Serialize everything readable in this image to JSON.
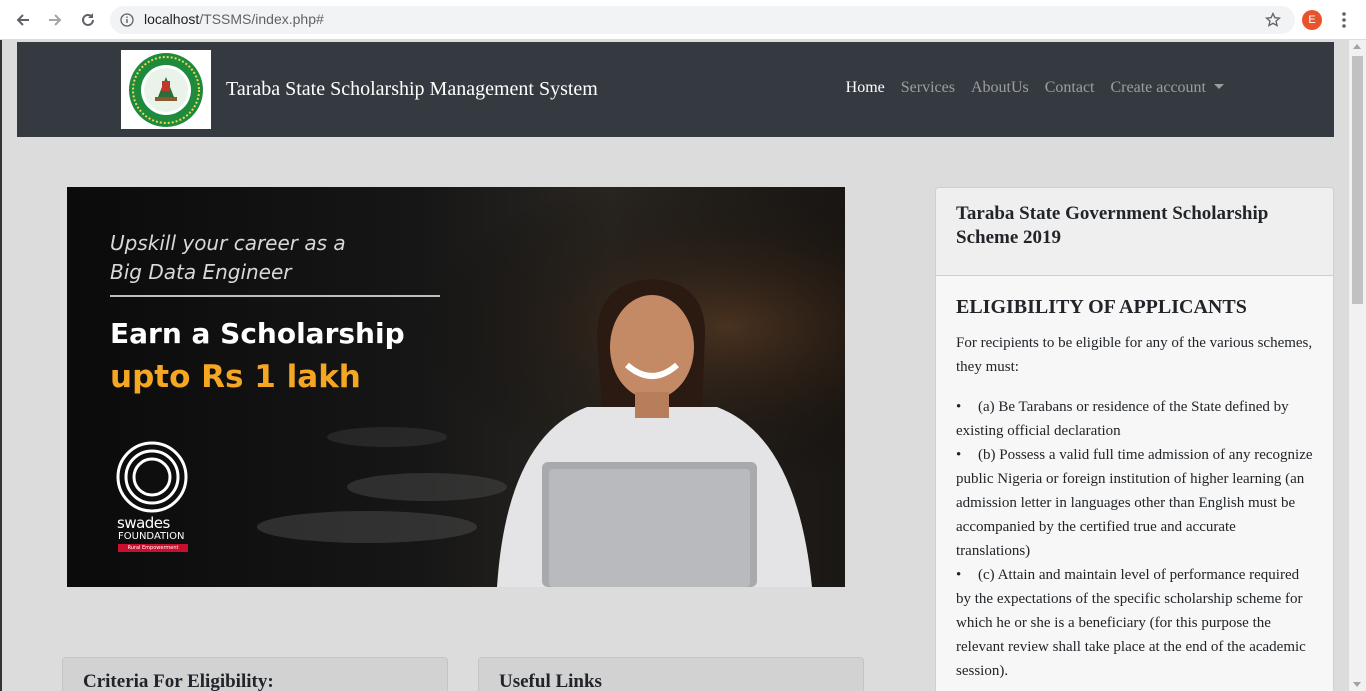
{
  "browser": {
    "url_host": "localhost",
    "url_path": "/TSSMS/index.php#",
    "profile_initial": "E",
    "accent_color": "#e8532b"
  },
  "navbar": {
    "brand": "Taraba State Scholarship Management System",
    "links": [
      "Home",
      "Services",
      "AboutUs",
      "Contact",
      "Create account"
    ],
    "background": "#343a40"
  },
  "banner": {
    "upskill_line1": "Upskill your career as a",
    "upskill_line2": "Big Data Engineer",
    "headline": "Earn a Scholarship",
    "amount": "upto Rs 1 lakh",
    "org_name": "swades",
    "org_sub": "FOUNDATION",
    "org_tagline": "Rural Empowerment",
    "amount_color": "#f5a623"
  },
  "side_card": {
    "title": "Taraba State Government Scholarship Scheme 2019",
    "heading": "ELIGIBILITY OF APPLICANTS",
    "intro": "For recipients to be eligible for any of the various schemes, they must:",
    "items": [
      "(a) Be Tarabans or residence of the State defined by existing official declaration",
      "(b) Possess a valid full time admission of any recognize public Nigeria or foreign institution of higher learning (an admission letter in languages other than English must be accompanied by the certified true and accurate translations)",
      "(c) Attain and maintain level of performance required by the expectations of the specific scholarship scheme for which he or she is a beneficiary (for this purpose the relevant review shall take place at the end of the academic session)."
    ]
  },
  "bottom_cards": {
    "criteria_title": "Criteria For Eligibility:",
    "links_title": "Useful Links"
  }
}
